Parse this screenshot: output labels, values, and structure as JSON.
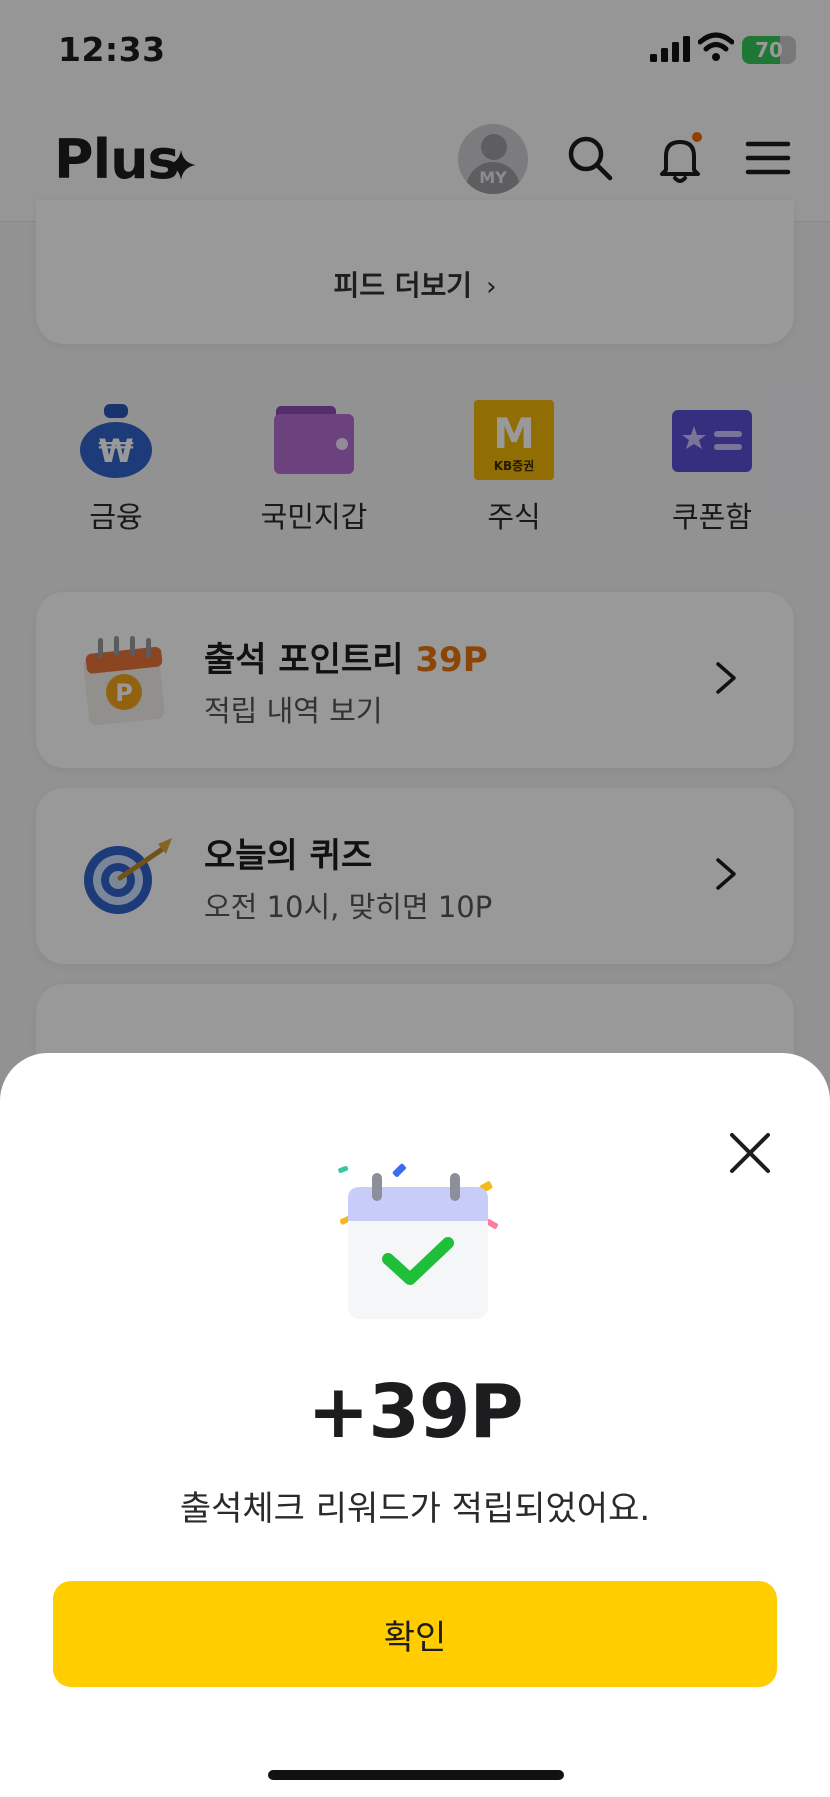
{
  "status_bar": {
    "time": "12:33",
    "battery_label": "70",
    "battery_level": 0.7
  },
  "header": {
    "logo": "Plus",
    "avatar_label": "MY",
    "icons": [
      "logo-star-icon",
      "search-icon",
      "bell-icon",
      "hamburger-menu-icon"
    ]
  },
  "feed": {
    "more_label": "피드 더보기",
    "chevron": "›"
  },
  "shortcuts": [
    {
      "label": "금융",
      "icon": "money-bag-icon"
    },
    {
      "label": "국민지갑",
      "icon": "wallet-icon"
    },
    {
      "label": "주식",
      "icon": "kb-securities-icon",
      "icon_text": "M",
      "icon_subtext": "KB증권"
    },
    {
      "label": "쿠폰함",
      "icon": "coupon-icon"
    }
  ],
  "cards": [
    {
      "title": "출석 포인트리",
      "accent": "39P",
      "subtitle": "적립 내역 보기",
      "icon": "calendar-point-icon",
      "icon_text": "P"
    },
    {
      "title": "오늘의 퀴즈",
      "subtitle": "오전 10시, 맞히면 10P",
      "icon": "target-icon"
    }
  ],
  "sheet": {
    "points": "+39P",
    "message": "출석체크 리워드가 적립되었어요.",
    "confirm_label": "확인",
    "icons": [
      "close-icon",
      "calendar-check-icon"
    ]
  },
  "colors": {
    "brand_yellow": "#ffcd00",
    "accent_orange": "#e8750c",
    "check_green": "#1fbf3a",
    "notification_dot": "#f56a00"
  }
}
